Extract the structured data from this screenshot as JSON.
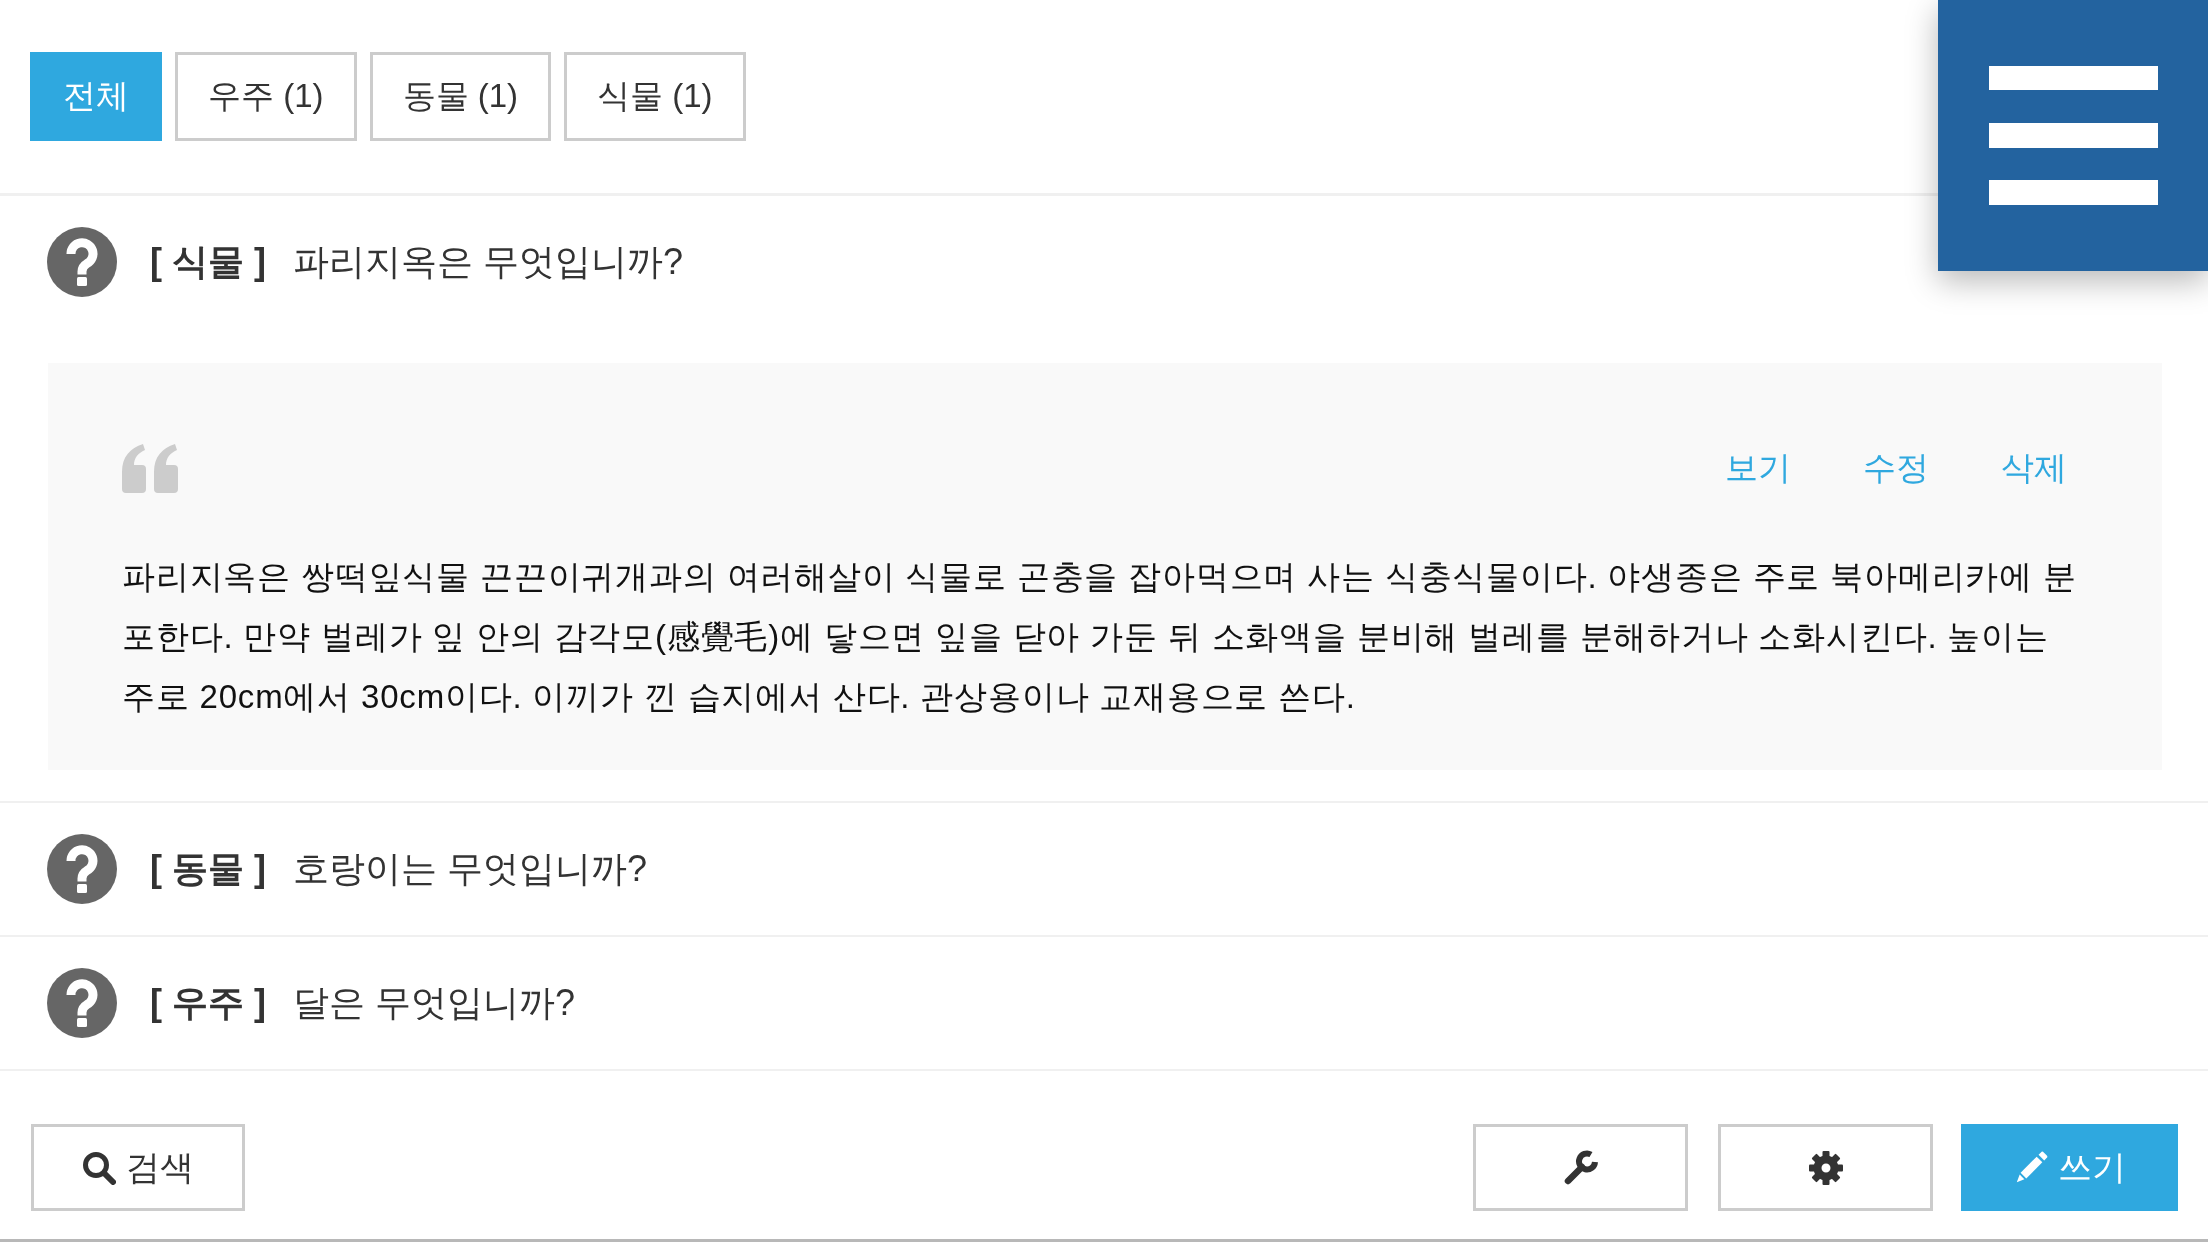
{
  "tabs": [
    {
      "label": "전체",
      "selected": true
    },
    {
      "label": "우주 (1)",
      "selected": false
    },
    {
      "label": "동물 (1)",
      "selected": false
    },
    {
      "label": "식물 (1)",
      "selected": false
    }
  ],
  "questions": [
    {
      "category": "[ 식물 ]",
      "question": "파리지옥은 무엇입니까?",
      "expanded": true,
      "answer": {
        "actions": [
          "보기",
          "수정",
          "삭제"
        ],
        "text": "파리지옥은 쌍떡잎식물 끈끈이귀개과의 여러해살이 식물로 곤충을 잡아먹으며 사는 식충식물이다. 야생종은 주로 북아메리카에 분포한다. 만약 벌레가 잎 안의 감각모(感覺毛)에 닿으면 잎을 닫아 가둔 뒤 소화액을 분비해 벌레를 분해하거나 소화시킨다. 높이는 주로 20cm에서 30cm이다. 이끼가 낀 습지에서 산다. 관상용이나 교재용으로 쓴다."
      }
    },
    {
      "category": "[ 동물 ]",
      "question": "호랑이는 무엇입니까?",
      "expanded": false
    },
    {
      "category": "[ 우주 ]",
      "question": "달은 무엇입니까?",
      "expanded": false
    }
  ],
  "toolbar": {
    "search_button": "검색",
    "write_button": "쓰기"
  }
}
